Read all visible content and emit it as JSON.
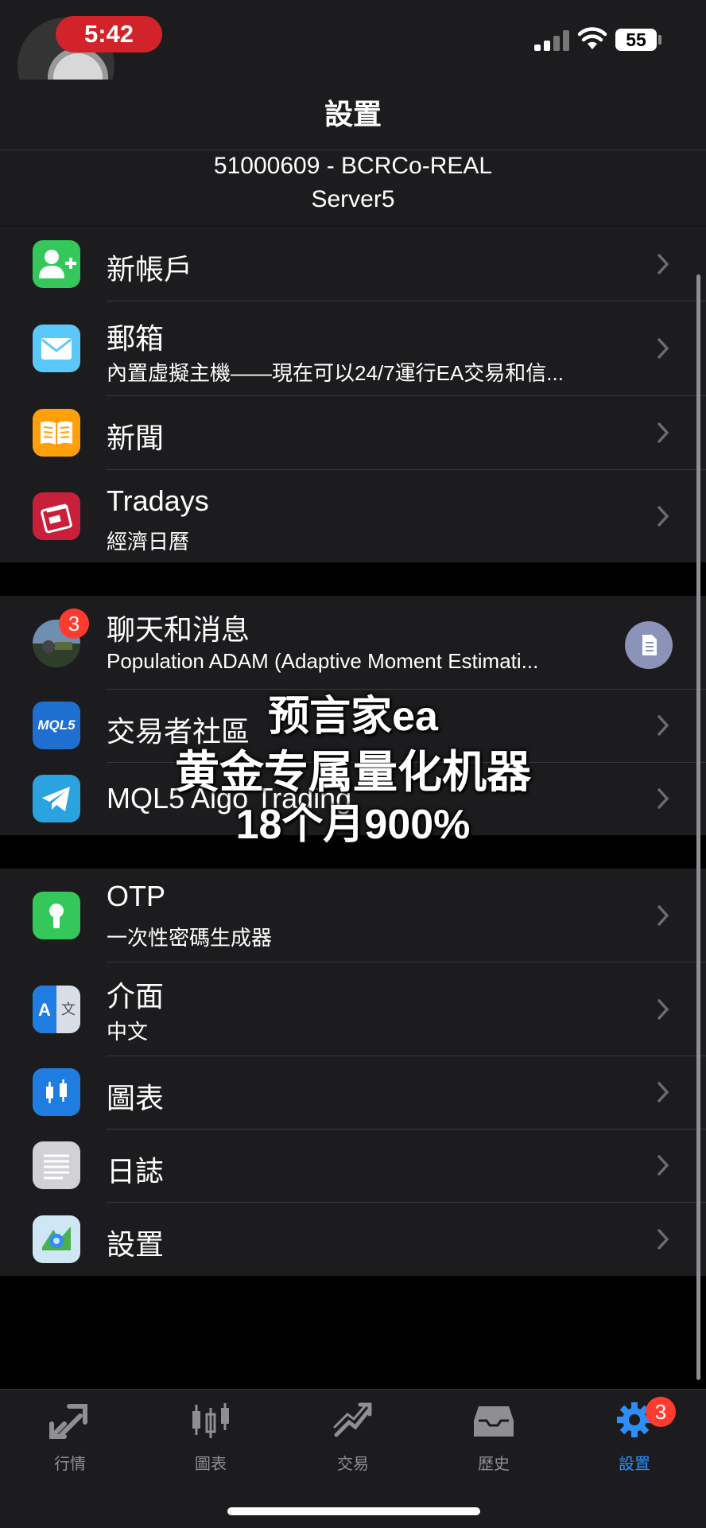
{
  "status": {
    "time": "5:42",
    "battery": "55"
  },
  "nav": {
    "title": "設置"
  },
  "account": {
    "line1": "51000609 - BCRCo-REAL",
    "line2": "Server5"
  },
  "group1": [
    {
      "title": "新帳戶",
      "subtitle": "",
      "icon": "add-user-icon"
    },
    {
      "title": "郵箱",
      "subtitle": "內置虛擬主機——現在可以24/7運行EA交易和信...",
      "icon": "mail-icon"
    },
    {
      "title": "新聞",
      "subtitle": "",
      "icon": "book-icon"
    },
    {
      "title": "Tradays",
      "subtitle": "經濟日曆",
      "icon": "calendar-icon"
    }
  ],
  "group2": [
    {
      "title": "聊天和消息",
      "subtitle": "Population ADAM (Adaptive Moment Estimati...",
      "badge": "3",
      "icon": "chat-avatar"
    },
    {
      "title": "交易者社區",
      "subtitle": "",
      "icon": "mql5-icon",
      "icon_text": "MQL5"
    },
    {
      "title": "MQL5 Algo Trading",
      "subtitle": "",
      "icon": "telegram-icon"
    }
  ],
  "group3": [
    {
      "title": "OTP",
      "subtitle": "一次性密碼生成器",
      "icon": "otp-icon"
    },
    {
      "title": "介面",
      "subtitle": "中文",
      "icon": "language-icon"
    },
    {
      "title": "圖表",
      "subtitle": "",
      "icon": "chart-icon"
    },
    {
      "title": "日誌",
      "subtitle": "",
      "icon": "journal-icon"
    },
    {
      "title": "設置",
      "subtitle": "",
      "icon": "settings-app-icon"
    }
  ],
  "overlay": {
    "line1": "预言家ea",
    "line2": "黄金专属量化机器",
    "line3": "18个月900%"
  },
  "tabs": [
    {
      "label": "行情",
      "icon": "quotes-icon",
      "active": false
    },
    {
      "label": "圖表",
      "icon": "charts-icon",
      "active": false
    },
    {
      "label": "交易",
      "icon": "trade-icon",
      "active": false
    },
    {
      "label": "歷史",
      "icon": "history-icon",
      "active": false
    },
    {
      "label": "設置",
      "icon": "settings-icon",
      "active": true,
      "badge": "3"
    }
  ],
  "colors": {
    "accent": "#2f8ef5",
    "badge": "#ff3b30",
    "background": "#000000",
    "cell": "#1c1c1e"
  }
}
